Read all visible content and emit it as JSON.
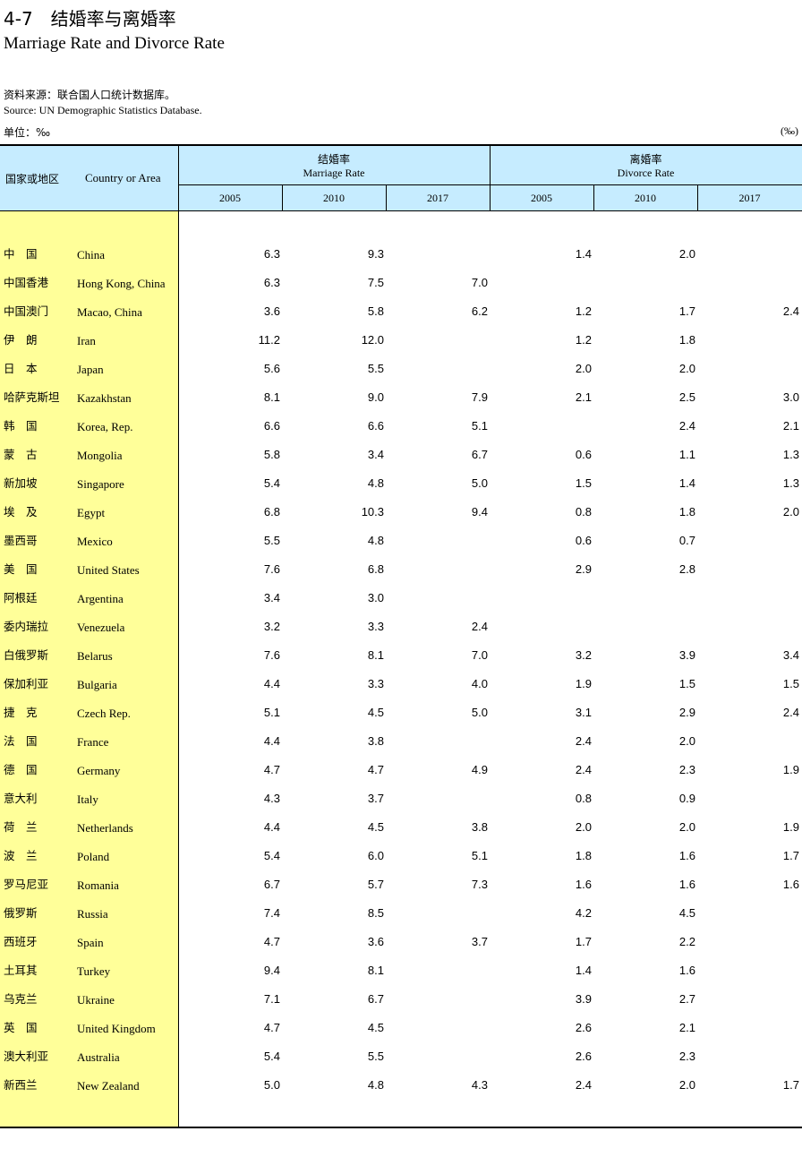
{
  "title": {
    "zh": "4-7　结婚率与离婚率",
    "en": "Marriage Rate and Divorce Rate"
  },
  "source": {
    "zh": "资料来源：联合国人口统计数据库。",
    "en": "Source: UN Demographic Statistics Database."
  },
  "unit": {
    "zh": "单位：‰",
    "right": "(‰)"
  },
  "header": {
    "stub_zh": "国家或地区",
    "stub_en": "Country or Area",
    "marriage_zh": "结婚率",
    "marriage_en": "Marriage Rate",
    "divorce_zh": "离婚率",
    "divorce_en": "Divorce Rate",
    "years": [
      "2005",
      "2010",
      "2017",
      "2005",
      "2010",
      "2017"
    ]
  },
  "rows": [
    {
      "zh": "中　国",
      "en": "China",
      "m2005": "6.3",
      "m2010": "9.3",
      "m2017": "",
      "d2005": "1.4",
      "d2010": "2.0",
      "d2017": ""
    },
    {
      "zh": "中国香港",
      "en": "Hong Kong, China",
      "m2005": "6.3",
      "m2010": "7.5",
      "m2017": "7.0",
      "d2005": "",
      "d2010": "",
      "d2017": ""
    },
    {
      "zh": "中国澳门",
      "en": "Macao, China",
      "m2005": "3.6",
      "m2010": "5.8",
      "m2017": "6.2",
      "d2005": "1.2",
      "d2010": "1.7",
      "d2017": "2.4"
    },
    {
      "zh": "伊　朗",
      "en": "Iran",
      "m2005": "11.2",
      "m2010": "12.0",
      "m2017": "",
      "d2005": "1.2",
      "d2010": "1.8",
      "d2017": ""
    },
    {
      "zh": "日　本",
      "en": "Japan",
      "m2005": "5.6",
      "m2010": "5.5",
      "m2017": "",
      "d2005": "2.0",
      "d2010": "2.0",
      "d2017": ""
    },
    {
      "zh": "哈萨克斯坦",
      "en": "Kazakhstan",
      "m2005": "8.1",
      "m2010": "9.0",
      "m2017": "7.9",
      "d2005": "2.1",
      "d2010": "2.5",
      "d2017": "3.0"
    },
    {
      "zh": "韩　国",
      "en": "Korea, Rep.",
      "m2005": "6.6",
      "m2010": "6.6",
      "m2017": "5.1",
      "d2005": "",
      "d2010": "2.4",
      "d2017": "2.1"
    },
    {
      "zh": "蒙　古",
      "en": "Mongolia",
      "m2005": "5.8",
      "m2010": "3.4",
      "m2017": "6.7",
      "d2005": "0.6",
      "d2010": "1.1",
      "d2017": "1.3"
    },
    {
      "zh": "新加坡",
      "en": "Singapore",
      "m2005": "5.4",
      "m2010": "4.8",
      "m2017": "5.0",
      "d2005": "1.5",
      "d2010": "1.4",
      "d2017": "1.3"
    },
    {
      "zh": "埃　及",
      "en": "Egypt",
      "m2005": "6.8",
      "m2010": "10.3",
      "m2017": "9.4",
      "d2005": "0.8",
      "d2010": "1.8",
      "d2017": "2.0"
    },
    {
      "zh": "墨西哥",
      "en": "Mexico",
      "m2005": "5.5",
      "m2010": "4.8",
      "m2017": "",
      "d2005": "0.6",
      "d2010": "0.7",
      "d2017": ""
    },
    {
      "zh": "美　国",
      "en": "United States",
      "m2005": "7.6",
      "m2010": "6.8",
      "m2017": "",
      "d2005": "2.9",
      "d2010": "2.8",
      "d2017": ""
    },
    {
      "zh": "阿根廷",
      "en": "Argentina",
      "m2005": "3.4",
      "m2010": "3.0",
      "m2017": "",
      "d2005": "",
      "d2010": "",
      "d2017": ""
    },
    {
      "zh": "委内瑞拉",
      "en": "Venezuela",
      "m2005": "3.2",
      "m2010": "3.3",
      "m2017": "2.4",
      "d2005": "",
      "d2010": "",
      "d2017": ""
    },
    {
      "zh": "白俄罗斯",
      "en": "Belarus",
      "m2005": "7.6",
      "m2010": "8.1",
      "m2017": "7.0",
      "d2005": "3.2",
      "d2010": "3.9",
      "d2017": "3.4"
    },
    {
      "zh": "保加利亚",
      "en": "Bulgaria",
      "m2005": "4.4",
      "m2010": "3.3",
      "m2017": "4.0",
      "d2005": "1.9",
      "d2010": "1.5",
      "d2017": "1.5"
    },
    {
      "zh": "捷　克",
      "en": "Czech Rep.",
      "m2005": "5.1",
      "m2010": "4.5",
      "m2017": "5.0",
      "d2005": "3.1",
      "d2010": "2.9",
      "d2017": "2.4"
    },
    {
      "zh": "法　国",
      "en": "France",
      "m2005": "4.4",
      "m2010": "3.8",
      "m2017": "",
      "d2005": "2.4",
      "d2010": "2.0",
      "d2017": ""
    },
    {
      "zh": "德　国",
      "en": "Germany",
      "m2005": "4.7",
      "m2010": "4.7",
      "m2017": "4.9",
      "d2005": "2.4",
      "d2010": "2.3",
      "d2017": "1.9"
    },
    {
      "zh": "意大利",
      "en": "Italy",
      "m2005": "4.3",
      "m2010": "3.7",
      "m2017": "",
      "d2005": "0.8",
      "d2010": "0.9",
      "d2017": ""
    },
    {
      "zh": "荷　兰",
      "en": "Netherlands",
      "m2005": "4.4",
      "m2010": "4.5",
      "m2017": "3.8",
      "d2005": "2.0",
      "d2010": "2.0",
      "d2017": "1.9"
    },
    {
      "zh": "波　兰",
      "en": "Poland",
      "m2005": "5.4",
      "m2010": "6.0",
      "m2017": "5.1",
      "d2005": "1.8",
      "d2010": "1.6",
      "d2017": "1.7"
    },
    {
      "zh": "罗马尼亚",
      "en": "Romania",
      "m2005": "6.7",
      "m2010": "5.7",
      "m2017": "7.3",
      "d2005": "1.6",
      "d2010": "1.6",
      "d2017": "1.6"
    },
    {
      "zh": "俄罗斯",
      "en": "Russia",
      "m2005": "7.4",
      "m2010": "8.5",
      "m2017": "",
      "d2005": "4.2",
      "d2010": "4.5",
      "d2017": ""
    },
    {
      "zh": "西班牙",
      "en": "Spain",
      "m2005": "4.7",
      "m2010": "3.6",
      "m2017": "3.7",
      "d2005": "1.7",
      "d2010": "2.2",
      "d2017": ""
    },
    {
      "zh": "土耳其",
      "en": "Turkey",
      "m2005": "9.4",
      "m2010": "8.1",
      "m2017": "",
      "d2005": "1.4",
      "d2010": "1.6",
      "d2017": ""
    },
    {
      "zh": "乌克兰",
      "en": "Ukraine",
      "m2005": "7.1",
      "m2010": "6.7",
      "m2017": "",
      "d2005": "3.9",
      "d2010": "2.7",
      "d2017": ""
    },
    {
      "zh": "英　国",
      "en": "United Kingdom",
      "m2005": "4.7",
      "m2010": "4.5",
      "m2017": "",
      "d2005": "2.6",
      "d2010": "2.1",
      "d2017": ""
    },
    {
      "zh": "澳大利亚",
      "en": "Australia",
      "m2005": "5.4",
      "m2010": "5.5",
      "m2017": "",
      "d2005": "2.6",
      "d2010": "2.3",
      "d2017": ""
    },
    {
      "zh": "新西兰",
      "en": "New Zealand",
      "m2005": "5.0",
      "m2010": "4.8",
      "m2017": "4.3",
      "d2005": "2.4",
      "d2010": "2.0",
      "d2017": "1.7"
    }
  ]
}
